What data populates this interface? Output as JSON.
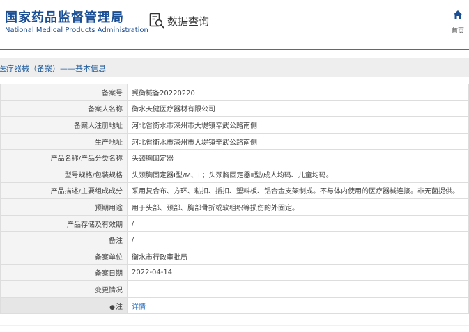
{
  "header": {
    "org_name_cn": "国家药品监督管理局",
    "org_name_en": "National Medical Products Administration",
    "query_label": "数据查询",
    "home_label": "首页"
  },
  "section": {
    "title": "医疗器械（备案）——基本信息"
  },
  "fields": [
    {
      "label": "备案号",
      "value": "冀衡械备20220220"
    },
    {
      "label": "备案人名称",
      "value": "衡水天健医疗器材有限公司"
    },
    {
      "label": "备案人注册地址",
      "value": "河北省衡水市深州市大堤镇辛武公路南侧"
    },
    {
      "label": "生产地址",
      "value": "河北省衡水市深州市大堤镇辛武公路南侧"
    },
    {
      "label": "产品名称/产品分类名称",
      "value": "头颈胸固定器"
    },
    {
      "label": "型号规格/包装规格",
      "value": "头颈胸固定器Ⅰ型/M、L；头颈胸固定器Ⅱ型/成人均码、儿童均码。"
    },
    {
      "label": "产品描述/主要组成成分",
      "value": "采用复合布、方环、粘扣、插扣、塑料板、铝合金支架制成。不与体内使用的医疗器械连接。非无菌提供。"
    },
    {
      "label": "预期用途",
      "value": "用于头部、颈部、胸部骨折或软组织等损伤的外固定。"
    },
    {
      "label": "产品存储及有效期",
      "value": "/"
    },
    {
      "label": "备注",
      "value": "/"
    },
    {
      "label": "备案单位",
      "value": "衡水市行政审批局"
    },
    {
      "label": "备案日期",
      "value": "2022-04-14"
    },
    {
      "label": "变更情况",
      "value": ""
    }
  ],
  "note_row": {
    "mark": "●",
    "label": "注",
    "link": "详情"
  },
  "colors": {
    "brand_blue": "#1a4f96",
    "accent_blue": "#2f72c3",
    "label_bg": "#f4f4f4",
    "section_bg": "#eeeeee"
  },
  "icons": {
    "query": "search-document-icon",
    "home": "home-icon"
  }
}
